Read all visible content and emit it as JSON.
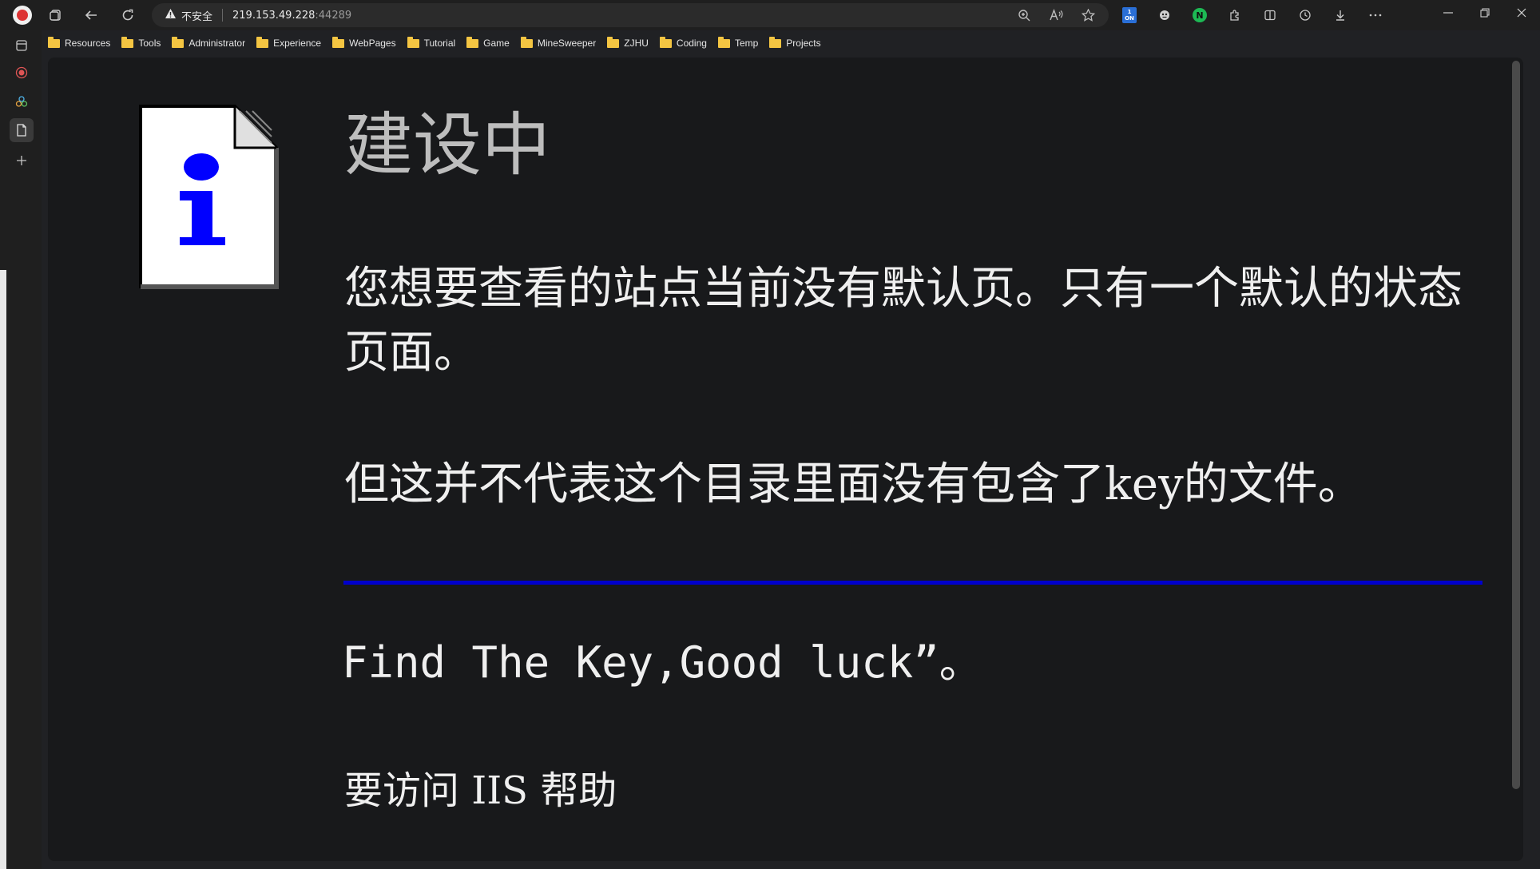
{
  "browser": {
    "address": {
      "security_label": "不安全",
      "host": "219.153.49.228",
      "port": ":44289"
    },
    "extension_on_label": "ON",
    "extension_n_label": "N",
    "bookmarks": [
      {
        "label": "Resources"
      },
      {
        "label": "Tools"
      },
      {
        "label": "Administrator"
      },
      {
        "label": "Experience"
      },
      {
        "label": "WebPages"
      },
      {
        "label": "Tutorial"
      },
      {
        "label": "Game"
      },
      {
        "label": "MineSweeper"
      },
      {
        "label": "ZJHU"
      },
      {
        "label": "Coding"
      },
      {
        "label": "Temp"
      },
      {
        "label": "Projects"
      }
    ]
  },
  "page": {
    "heading": "建设中",
    "paragraph1": "您想要查看的站点当前没有默认页。只有一个默认的状态页面。",
    "paragraph2": "但这并不代表这个目录里面没有包含了key的文件。",
    "find_key": "Find The Key,Good luck”。",
    "iis_help": "要访问 IIS 帮助",
    "colors": {
      "divider": "#0000cc",
      "icon_glyph": "#0000ff",
      "heading": "#bdbdbd",
      "text": "#efefef",
      "background": "#18191b"
    }
  }
}
